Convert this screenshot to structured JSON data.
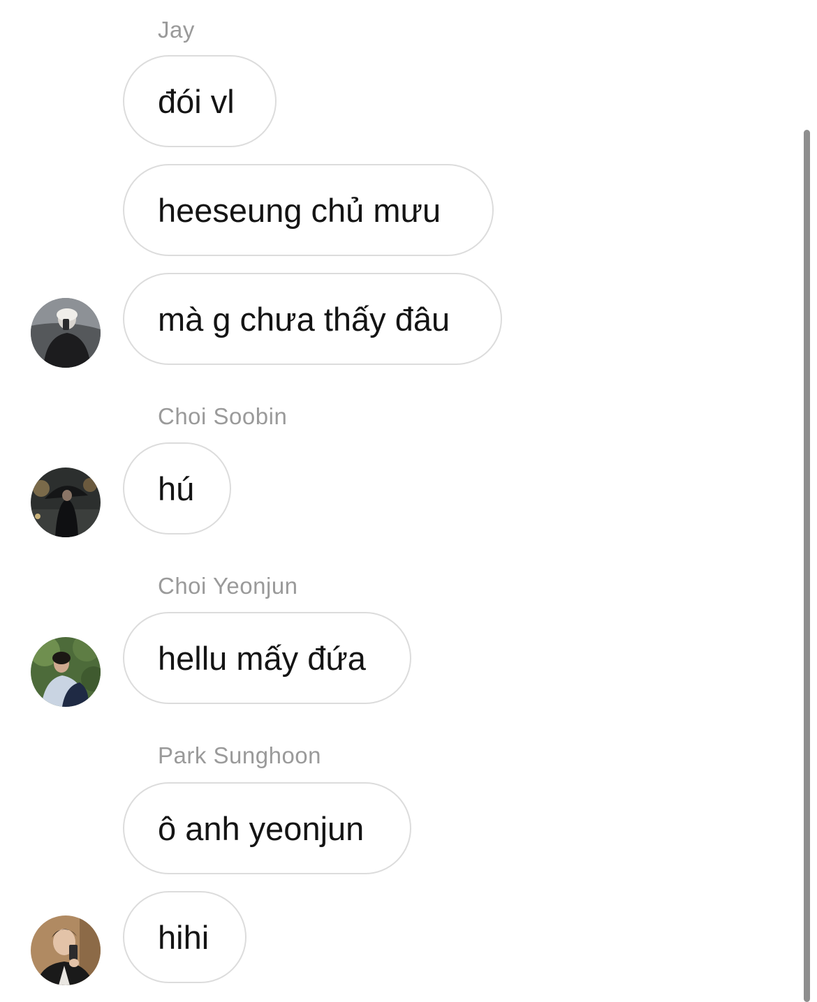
{
  "messages": [
    {
      "sender": "Jay",
      "bubbles": [
        "đói vl",
        "heeseung chủ mưu",
        "mà g chưa thấy đâu"
      ]
    },
    {
      "sender": "Choi Soobin",
      "bubbles": [
        "hú"
      ]
    },
    {
      "sender": "Choi Yeonjun",
      "bubbles": [
        "hellu mấy đứa"
      ]
    },
    {
      "sender": "Park Sunghoon",
      "bubbles": [
        "ô anh yeonjun",
        "hihi"
      ]
    }
  ],
  "colors": {
    "background": "#ffffff",
    "bubble_border": "#dcdcdc",
    "sender_text": "#9a9a9a",
    "message_text": "#141414",
    "scrollbar": "#8e8e8e"
  }
}
